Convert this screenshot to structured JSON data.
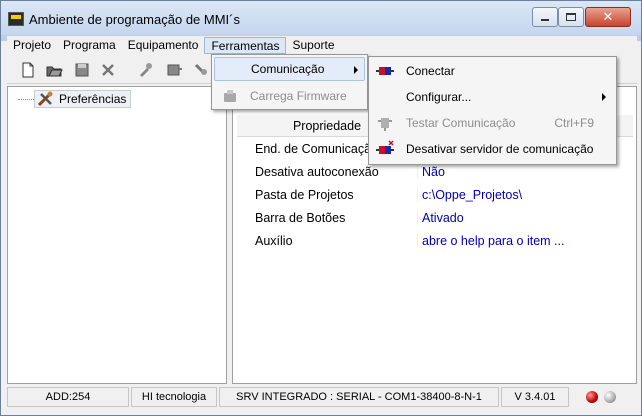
{
  "window": {
    "title": "Ambiente de programação de MMI´s"
  },
  "menubar": {
    "items": [
      {
        "label": "Projeto"
      },
      {
        "label": "Programa"
      },
      {
        "label": "Equipamento"
      },
      {
        "label": "Ferramentas"
      },
      {
        "label": "Suporte"
      }
    ]
  },
  "tree": {
    "root_label": "Preferências"
  },
  "grid": {
    "header": "Propriedade",
    "rows": [
      {
        "name": "End. de Comunicação",
        "value": ""
      },
      {
        "name": "Desativa autoconexão",
        "value": "Não"
      },
      {
        "name": "Pasta de Projetos",
        "value": "c:\\Oppe_Projetos\\"
      },
      {
        "name": "Barra de Botões",
        "value": "Ativado"
      },
      {
        "name": "Auxílio",
        "value": "abre o help para o item ..."
      }
    ]
  },
  "statusbar": {
    "address": "ADD:254",
    "company": "HI tecnologia",
    "server": "SRV INTEGRADO : SERIAL - COM1-38400-8-N-1",
    "version": "V 3.4.01"
  },
  "ferramentas_menu": {
    "items": [
      {
        "label": "Comunicação"
      },
      {
        "label": "Carrega  Firmware"
      }
    ]
  },
  "comunicacao_submenu": {
    "items": [
      {
        "label": "Conectar"
      },
      {
        "label": "Configurar..."
      },
      {
        "label": "Testar Comunicação",
        "shortcut": "Ctrl+F9"
      },
      {
        "label": "Desativar servidor de comunicação"
      }
    ]
  },
  "colors": {
    "value_text": "#0000aa",
    "highlight": "#e3ecf8",
    "connector_red": "#c8102e",
    "connector_blue": "#1a2aa0"
  }
}
